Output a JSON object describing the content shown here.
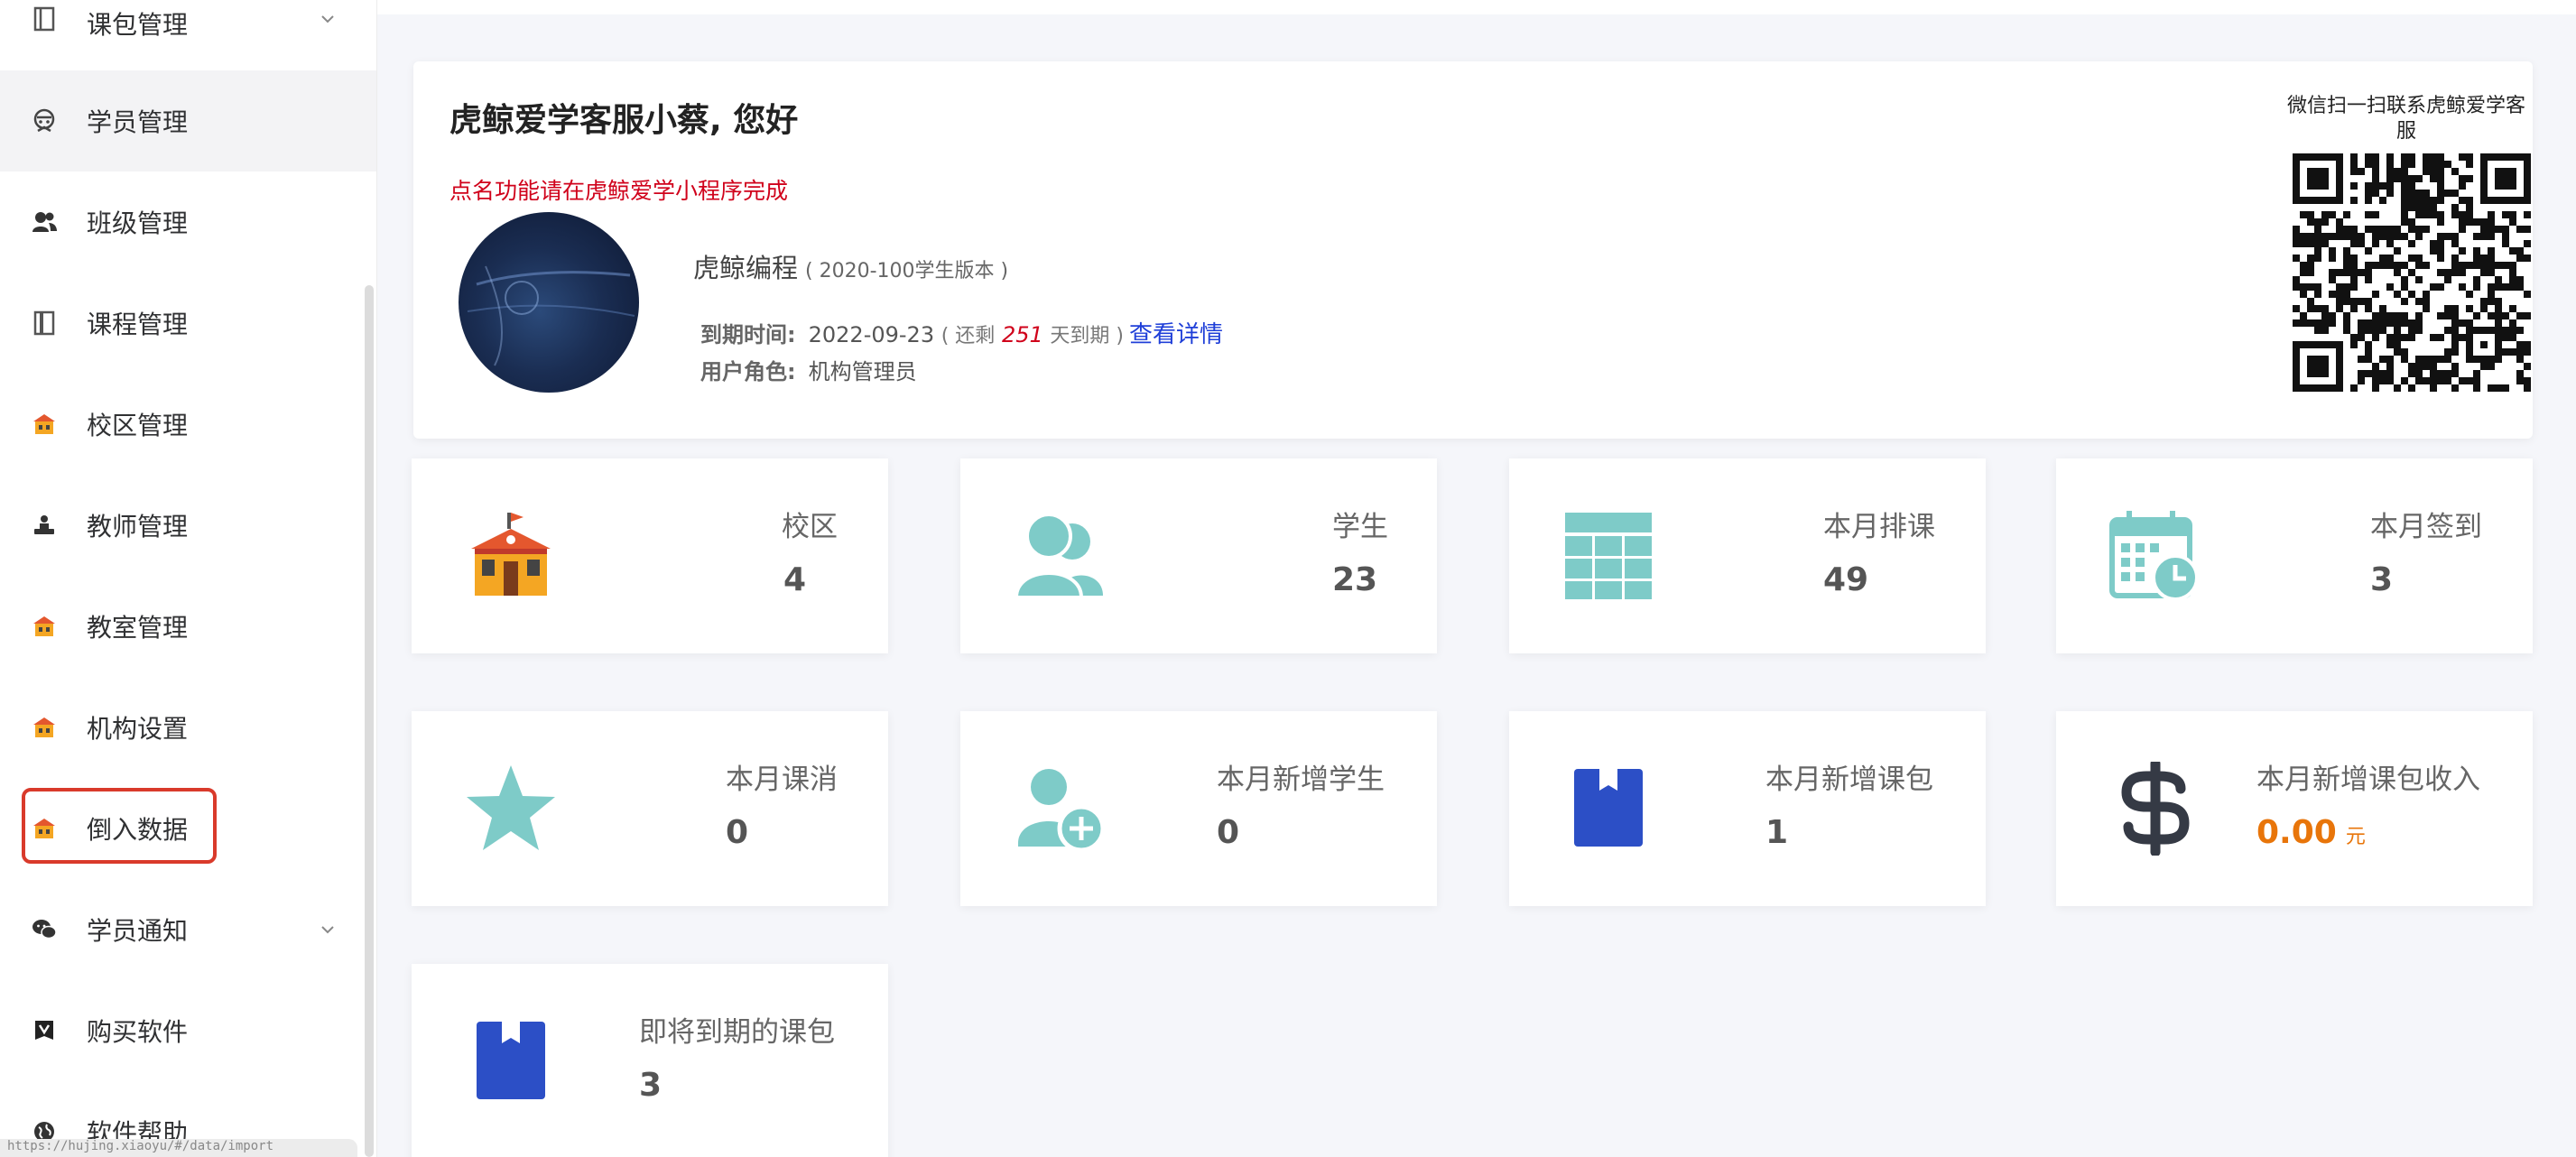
{
  "sidebar": {
    "items": [
      {
        "label": "课包管理"
      },
      {
        "label": "学员管理"
      },
      {
        "label": "班级管理"
      },
      {
        "label": "课程管理"
      },
      {
        "label": "校区管理"
      },
      {
        "label": "教师管理"
      },
      {
        "label": "教室管理"
      },
      {
        "label": "机构设置"
      },
      {
        "label": "倒入数据"
      },
      {
        "label": "学员通知"
      },
      {
        "label": "购买软件"
      },
      {
        "label": "软件帮助"
      }
    ],
    "active_item": "学员管理",
    "highlighted_item": "倒入数据",
    "status_url": "https://hujing.xiaoyu/#/data/import"
  },
  "welcome": {
    "greeting": "虎鲸爱学客服小蔡, 您好",
    "notice": "点名功能请在虎鲸爱学小程序完成",
    "org_name": "虎鲸编程",
    "version": "( 2020-100学生版本 )",
    "expire_label": "到期时间:",
    "expire_date": "2022-09-23",
    "remain_prefix": "( 还剩",
    "remain_days": "251",
    "remain_suffix": "天到期 )",
    "details_link": "查看详情",
    "role_label": "用户角色:",
    "role_value": "机构管理员",
    "qr_title": "微信扫一扫联系虎鲸爱学客服"
  },
  "stats": [
    {
      "label": "校区",
      "value": "4",
      "icon": "school-building-icon"
    },
    {
      "label": "学生",
      "value": "23",
      "icon": "users-icon"
    },
    {
      "label": "本月排课",
      "value": "49",
      "icon": "table-grid-icon"
    },
    {
      "label": "本月签到",
      "value": "3",
      "icon": "calendar-clock-icon"
    },
    {
      "label": "本月课消",
      "value": "0",
      "icon": "star-icon"
    },
    {
      "label": "本月新增学生",
      "value": "0",
      "icon": "add-user-icon"
    },
    {
      "label": "本月新增课包",
      "value": "1",
      "icon": "bookmark-icon"
    },
    {
      "label": "本月新增课包收入",
      "value": "0.00",
      "unit": "元",
      "icon": "dollar-icon"
    },
    {
      "label": "即将到期的课包",
      "value": "3",
      "icon": "bookmark-icon"
    }
  ],
  "colors": {
    "teal": "#7ecbc8",
    "blue": "#2c4fc6",
    "red": "#d0021b",
    "orange": "#e8750a",
    "link": "#1f3fd8"
  }
}
